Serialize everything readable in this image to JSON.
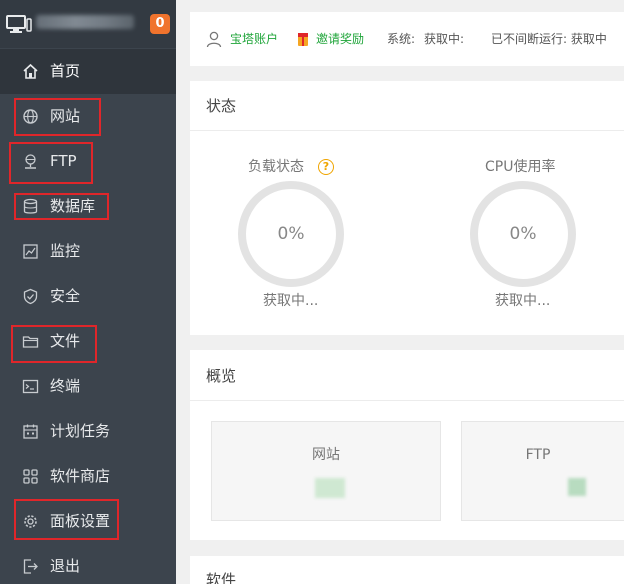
{
  "sidebar": {
    "badge_count": "0",
    "items": [
      {
        "label": "首页",
        "icon": "home-icon"
      },
      {
        "label": "网站",
        "icon": "globe-icon"
      },
      {
        "label": "FTP",
        "icon": "ftp-icon"
      },
      {
        "label": "数据库",
        "icon": "database-icon"
      },
      {
        "label": "监控",
        "icon": "monitor-chart-icon"
      },
      {
        "label": "安全",
        "icon": "shield-icon"
      },
      {
        "label": "文件",
        "icon": "folder-icon"
      },
      {
        "label": "终端",
        "icon": "terminal-icon"
      },
      {
        "label": "计划任务",
        "icon": "calendar-icon"
      },
      {
        "label": "软件商店",
        "icon": "grid-icon"
      },
      {
        "label": "面板设置",
        "icon": "gear-icon"
      },
      {
        "label": "退出",
        "icon": "logout-icon"
      }
    ]
  },
  "topbar": {
    "account": "宝塔账户",
    "invite": "邀请奖励",
    "system_label": "系统:",
    "system_value": "获取中:",
    "uptime": "已不间断运行: 获取中"
  },
  "status": {
    "title": "状态",
    "load": {
      "title": "负载状态",
      "value": "0%",
      "sub": "获取中..."
    },
    "cpu": {
      "title": "CPU使用率",
      "value": "0%",
      "sub": "获取中..."
    }
  },
  "overview": {
    "title": "概览",
    "cards": [
      {
        "title": "网站"
      },
      {
        "title": "FTP"
      }
    ]
  },
  "software": {
    "title": "软件"
  },
  "colors": {
    "sidebar_bg": "#3c444d",
    "accent_green": "#20a53a",
    "badge_orange": "#f0732d",
    "highlight_red": "#e0262a"
  }
}
